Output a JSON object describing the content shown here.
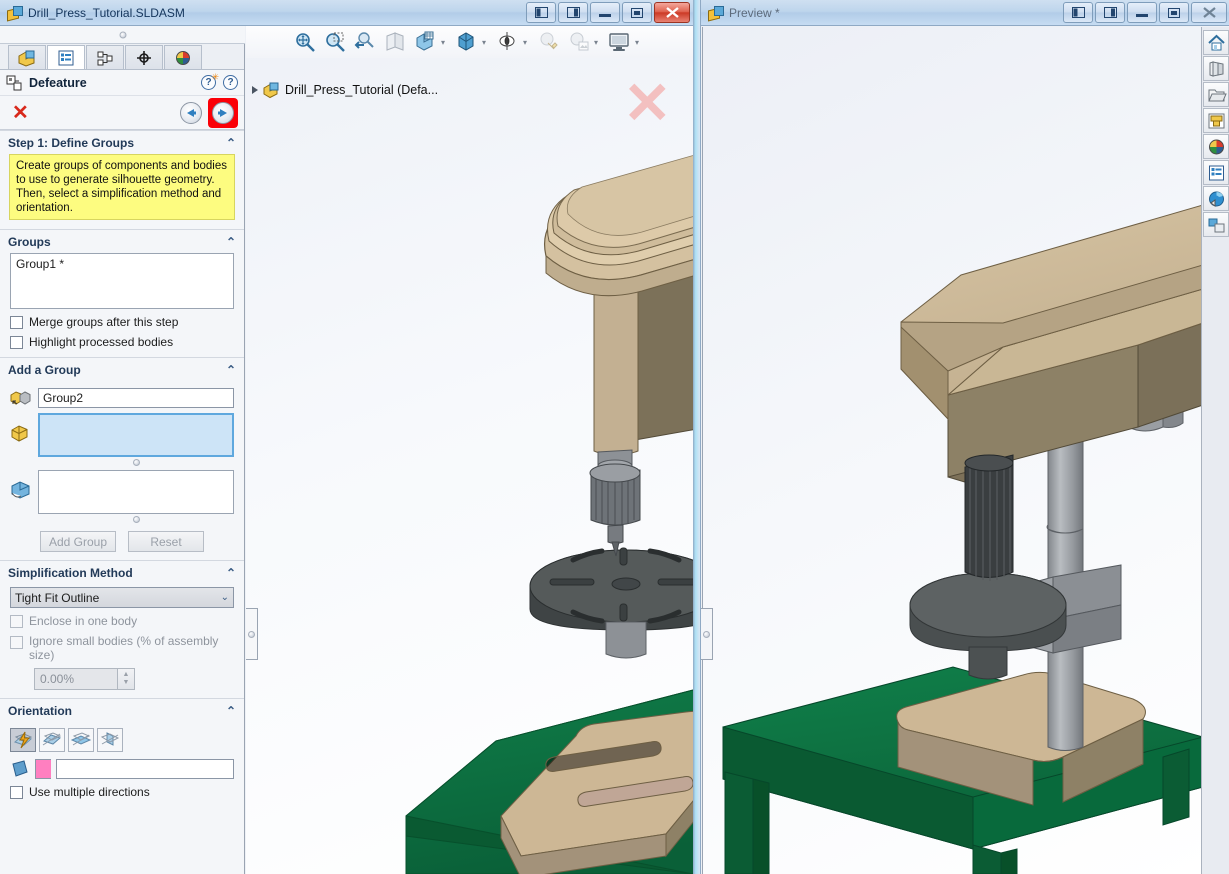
{
  "left_window": {
    "title": "Drill_Press_Tutorial.SLDASM",
    "doc_icon": "assembly-icon",
    "buttons": [
      {
        "name": "restore-left-pane",
        "glyph": "◧"
      },
      {
        "name": "restore-right-pane",
        "glyph": "◨"
      },
      {
        "name": "minimize",
        "glyph": "—"
      },
      {
        "name": "maximize",
        "glyph": "▭"
      },
      {
        "name": "close",
        "glyph": "✕"
      }
    ]
  },
  "feature_manager": {
    "tabs": [
      {
        "name": "feature-tree-tab",
        "icon": "assembly-tree-icon",
        "active": false
      },
      {
        "name": "property-manager-tab",
        "icon": "property-list-icon",
        "active": true
      },
      {
        "name": "configuration-manager-tab",
        "icon": "configuration-icon",
        "active": false
      },
      {
        "name": "dimxpert-manager-tab",
        "icon": "dimxpert-target-icon",
        "active": false
      },
      {
        "name": "display-manager-tab",
        "icon": "appearance-sphere-icon",
        "active": false
      }
    ],
    "property_manager": {
      "title": "Defeature",
      "icon": "defeature-icon",
      "whats_new_icon": "whats-new-help-icon",
      "help_icon": "help-question-icon",
      "cancel_icon": "cancel-x-icon",
      "back_icon": "back-arrow-icon",
      "next_icon": "next-arrow-icon",
      "next_highlighted": true,
      "highlight_color": "#fb0007"
    },
    "sections": {
      "step1": {
        "header": "Step 1: Define Groups",
        "hint": "Create groups of components and bodies to use to generate silhouette geometry. Then, select a simplification method and orientation."
      },
      "groups": {
        "header": "Groups",
        "items": [
          "Group1 *"
        ],
        "checkboxes": [
          {
            "label": "Merge groups after this step",
            "checked": false,
            "enabled": true
          },
          {
            "label": "Highlight processed bodies",
            "checked": false,
            "enabled": true
          }
        ]
      },
      "add_group": {
        "header": "Add a Group",
        "name_icon": "group-name-icon",
        "name_value": "Group2",
        "components_icon": "components-box-icon",
        "components_value": "",
        "components_selected": true,
        "bodies_icon": "bodies-solid-icon",
        "bodies_value": "",
        "add_button": "Add Group",
        "reset_button": "Reset",
        "buttons_enabled": false
      },
      "simplification": {
        "header": "Simplification Method",
        "method_value": "Tight Fit Outline",
        "checkboxes": [
          {
            "label": "Enclose in one body",
            "checked": false,
            "enabled": false
          },
          {
            "label": "Ignore small bodies (% of assembly size)",
            "checked": false,
            "enabled": false
          }
        ],
        "percent_value": "0.00%"
      },
      "orientation": {
        "header": "Orientation",
        "buttons": [
          {
            "name": "orientation-auto",
            "icon": "auto-orient-lightning-icon",
            "active": true
          },
          {
            "name": "orientation-along-x",
            "icon": "orient-plane-x-icon",
            "active": false
          },
          {
            "name": "orientation-along-y",
            "icon": "orient-plane-y-icon",
            "active": false
          },
          {
            "name": "orientation-along-z",
            "icon": "orient-plane-z-icon",
            "active": false
          }
        ],
        "plane_icon": "reference-plane-icon",
        "direction_swatch": "#ff7fc0",
        "direction_value": "",
        "use_multiple": {
          "label": "Use multiple directions",
          "checked": false
        }
      }
    }
  },
  "view_toolbar": {
    "items": [
      {
        "name": "zoom-to-fit-icon",
        "caret": false
      },
      {
        "name": "zoom-to-area-icon",
        "caret": false
      },
      {
        "name": "previous-view-icon",
        "caret": false
      },
      {
        "name": "section-view-icon",
        "caret": false
      },
      {
        "name": "view-orientation-icon",
        "caret": true
      },
      {
        "name": "display-style-icon",
        "caret": true
      },
      {
        "name": "hide-show-items-icon",
        "caret": true
      },
      {
        "name": "edit-appearance-icon",
        "caret": true
      },
      {
        "name": "apply-scene-icon",
        "caret": true
      },
      {
        "name": "view-settings-icon",
        "caret": true
      }
    ]
  },
  "model_tree": {
    "expand_icon": "expand-triangle-icon",
    "node_icon": "assembly-icon",
    "label": "Drill_Press_Tutorial  (Defa..."
  },
  "ghost_marker": {
    "name": "ghost-x-marker",
    "glyph": "✕",
    "color": "#f3c0c0"
  },
  "right_window": {
    "title": "Preview *",
    "doc_icon": "preview-assembly-icon",
    "buttons": [
      {
        "name": "restore-left-pane",
        "glyph": "◧"
      },
      {
        "name": "restore-right-pane",
        "glyph": "◨"
      },
      {
        "name": "minimize",
        "glyph": "—"
      },
      {
        "name": "maximize",
        "glyph": "▭"
      },
      {
        "name": "close",
        "glyph": "✕"
      }
    ]
  },
  "task_pane": {
    "items": [
      {
        "name": "sw-resources-home-icon"
      },
      {
        "name": "design-library-icon"
      },
      {
        "name": "file-explorer-icon"
      },
      {
        "name": "view-palette-icon"
      },
      {
        "name": "appearances-scenes-icon"
      },
      {
        "name": "custom-properties-icon"
      },
      {
        "name": "sw-forum-icon"
      },
      {
        "name": "dimxpert-pane-icon"
      }
    ]
  },
  "model_colors": {
    "head_tan_light": "#d4c1a0",
    "head_tan_mid": "#b7a385",
    "head_tan_dark": "#8e8166",
    "steel_light": "#b4b8bc",
    "steel_mid": "#9a9ea3",
    "steel_dark": "#7d8186",
    "table_dark": "#555a5a",
    "table_darker": "#3f4344",
    "bench_green": "#0d7340",
    "bench_green_dark": "#0a5a32",
    "base_tan": "#cdb795"
  }
}
